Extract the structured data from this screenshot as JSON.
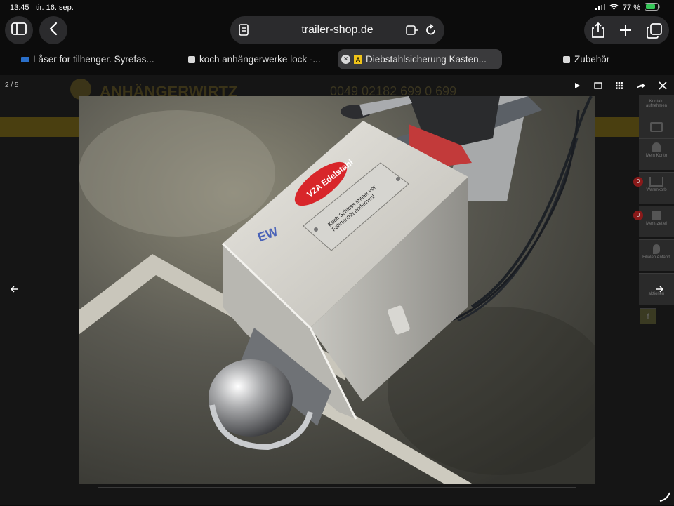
{
  "status": {
    "time": "13:45",
    "date": "tir. 16. sep.",
    "battery": "77 %"
  },
  "toolbar": {
    "url": "trailer-shop.de",
    "icons": [
      "sidebar-icon",
      "back-icon",
      "page-menu-icon",
      "translate-icon",
      "reload-icon",
      "share-icon",
      "plus-icon",
      "tabs-icon"
    ]
  },
  "tabs": [
    {
      "label": "Låser for tilhenger. Syrefas...",
      "active": false
    },
    {
      "label": "koch anhängerwerke lock -...",
      "active": false
    },
    {
      "label": "Diebstahlsicherung Kasten...",
      "active": true
    },
    {
      "label": "Zubehör",
      "active": false
    }
  ],
  "site": {
    "logo": "ANHÄNGERWIRTZ",
    "phone": "0049  02182  699 0 699",
    "sidebar": [
      {
        "label": "Kontakt aufnehmen"
      },
      {
        "label": "Mein Konto"
      },
      {
        "label": "Warenkorb",
        "badge": "0"
      },
      {
        "label": "Merk-zettel",
        "badge": "0"
      },
      {
        "label": "Filialen Anfahrt"
      },
      {
        "label": "aktionen"
      },
      {
        "label": "f"
      }
    ]
  },
  "lightbox": {
    "counter": "2 / 5",
    "tools": [
      "play-icon",
      "fullscreen-icon",
      "grid-icon",
      "share-icon",
      "close-icon"
    ]
  },
  "photo": {
    "sticker": "V2A Edelstahl",
    "plate": "Koch Schloss immer vor Fahrtantritt entfernen!",
    "marking": "EW"
  },
  "colors": {
    "accent": "#d6b52a",
    "tab_active": "#3a3a3c",
    "pill": "#2b2b2d"
  }
}
